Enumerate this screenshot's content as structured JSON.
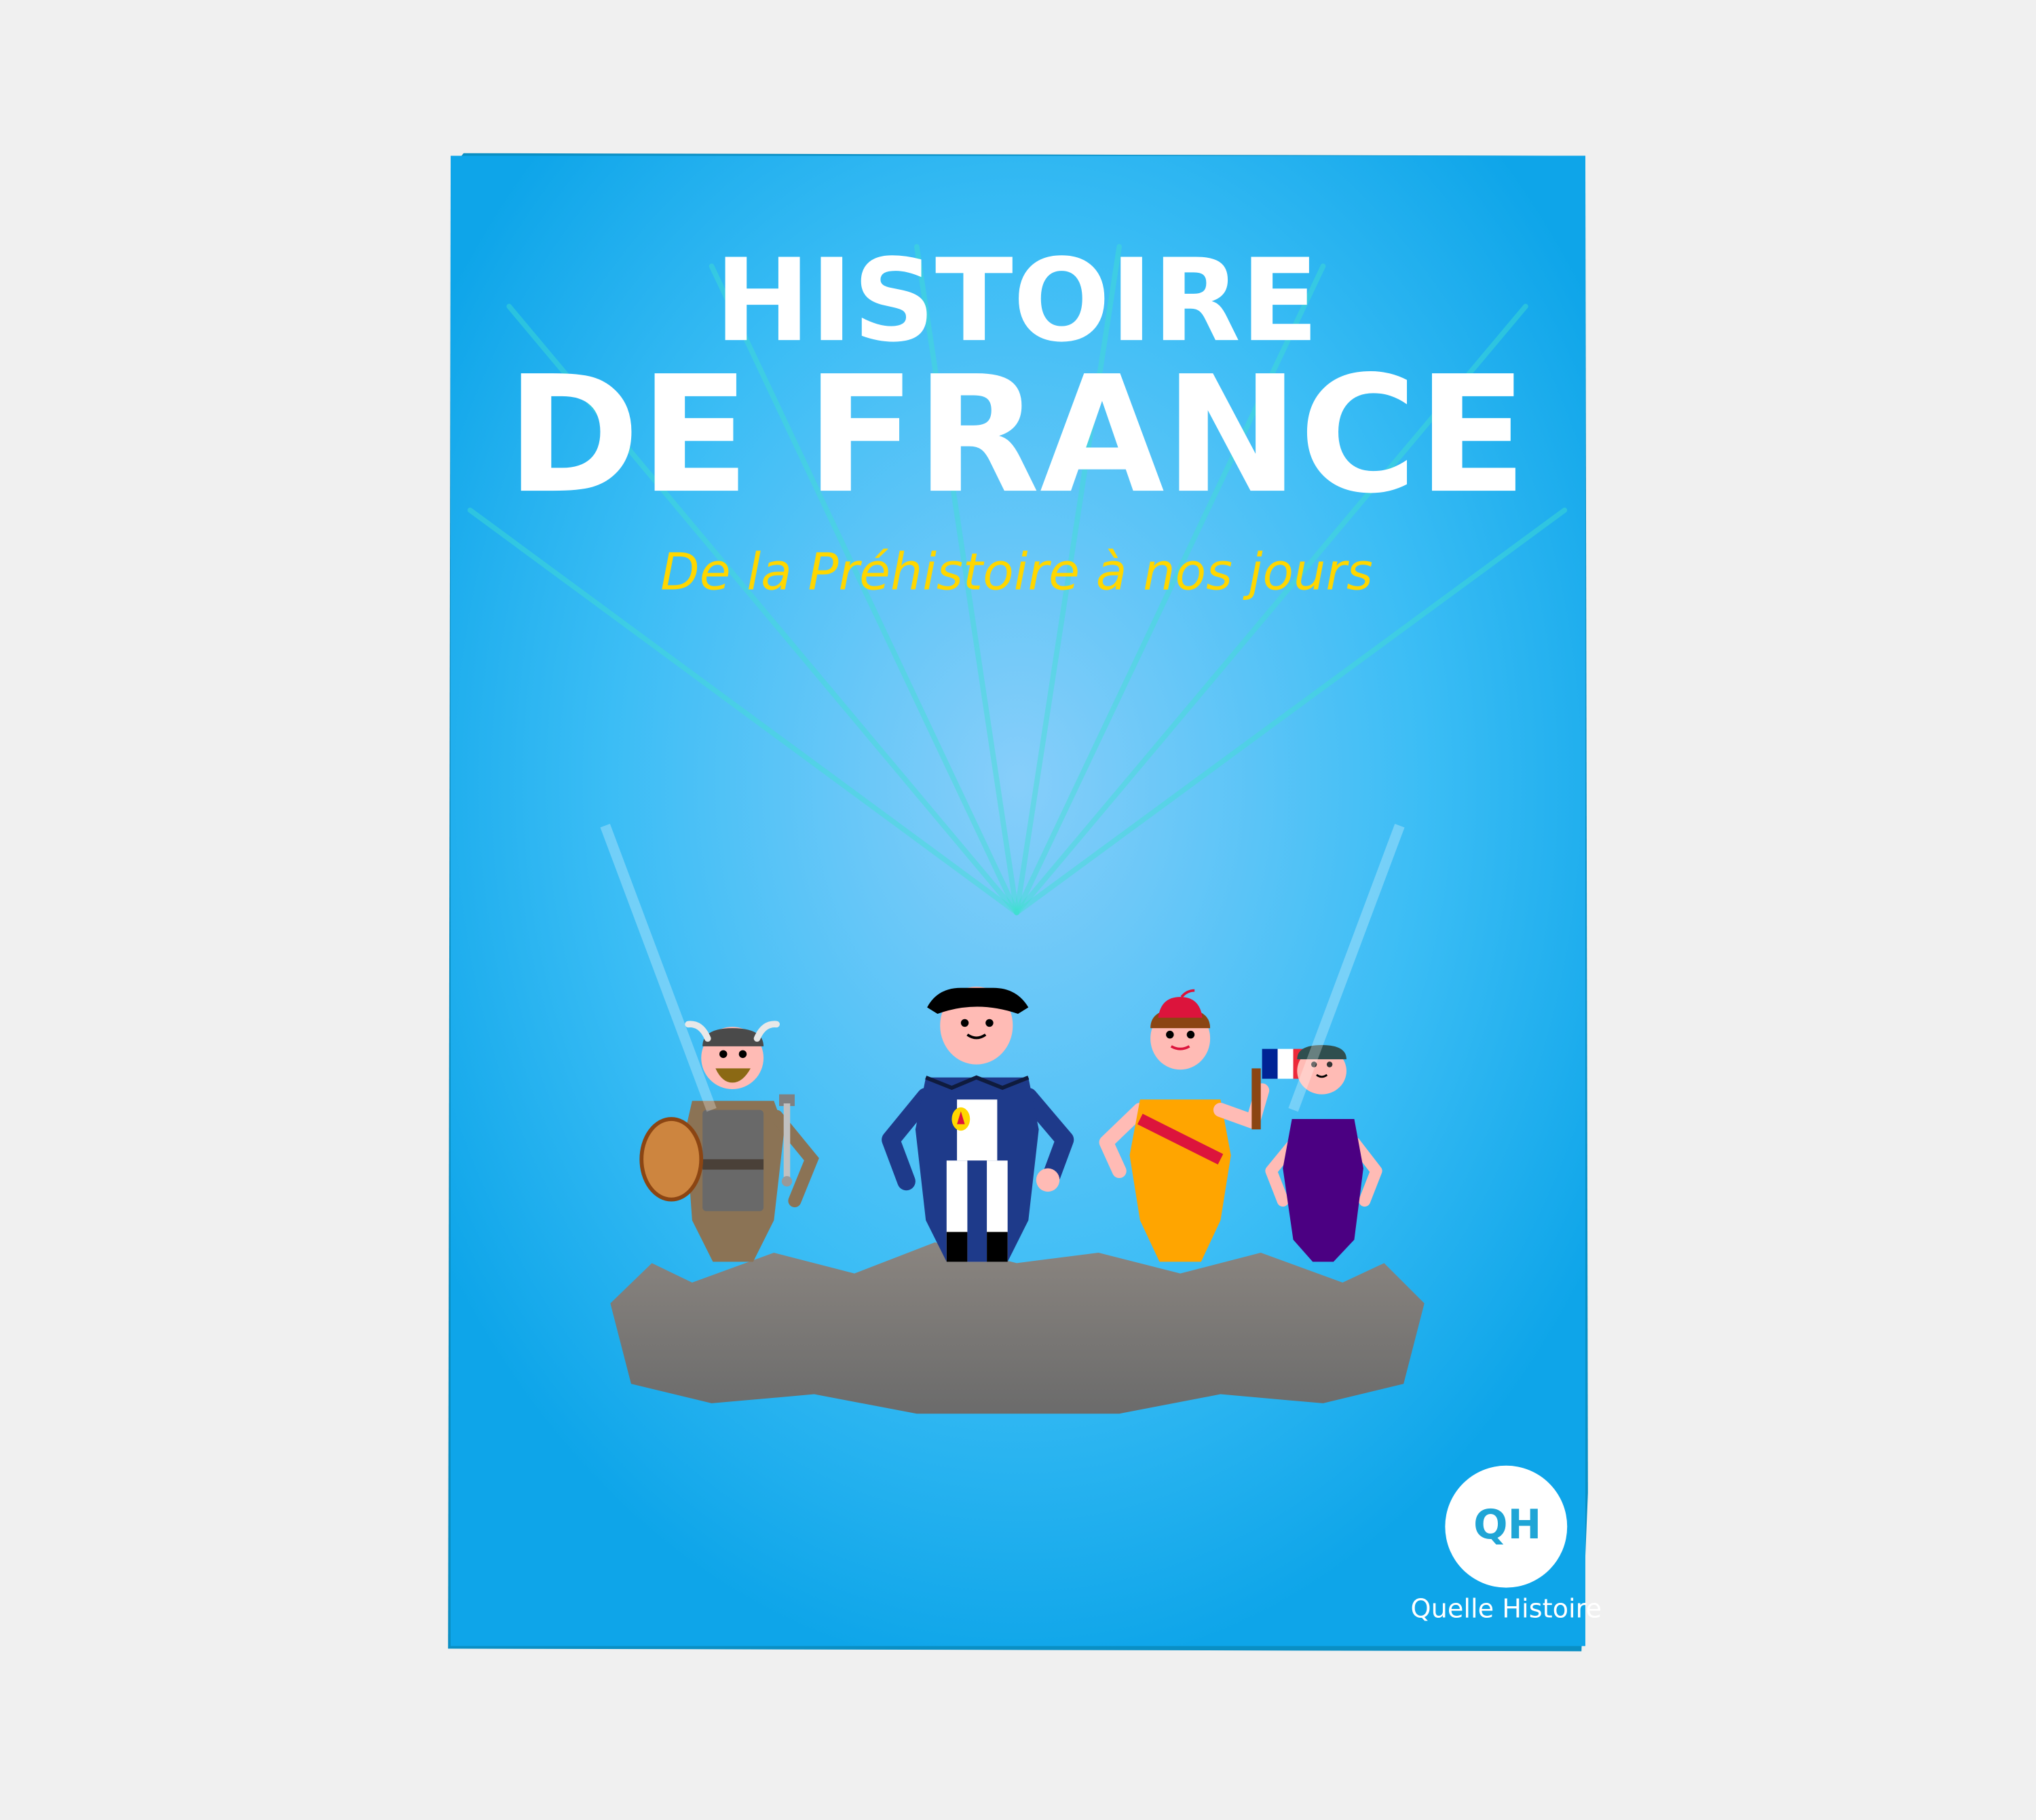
{
  "cover": {
    "title_line1": "HISTOIRE",
    "title_line2": "DE FRANCE",
    "subtitle": "De la Préhistoire à nos jours"
  },
  "publisher": {
    "logo_initials": "QH",
    "name": "Quelle Histoire"
  },
  "colors": {
    "background_center": "#87CEFA",
    "background_edge": "#0EA5E9",
    "title": "#FFFFFF",
    "subtitle": "#FFD700",
    "logo_text": "#1FA5D6"
  }
}
